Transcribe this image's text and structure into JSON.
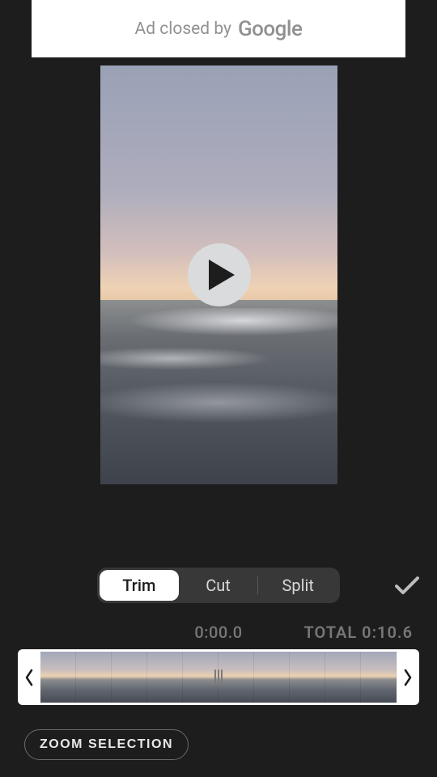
{
  "ad": {
    "text": "Ad closed by",
    "brand": "Google"
  },
  "tabs": {
    "trim": "Trim",
    "cut": "Cut",
    "split": "Split",
    "active": "Trim"
  },
  "time": {
    "current": "0:00.0",
    "total_label": "TOTAL",
    "total_value": "0:10.6"
  },
  "zoom_label": "ZOOM SELECTION",
  "timeline": {
    "frame_count": 10
  }
}
